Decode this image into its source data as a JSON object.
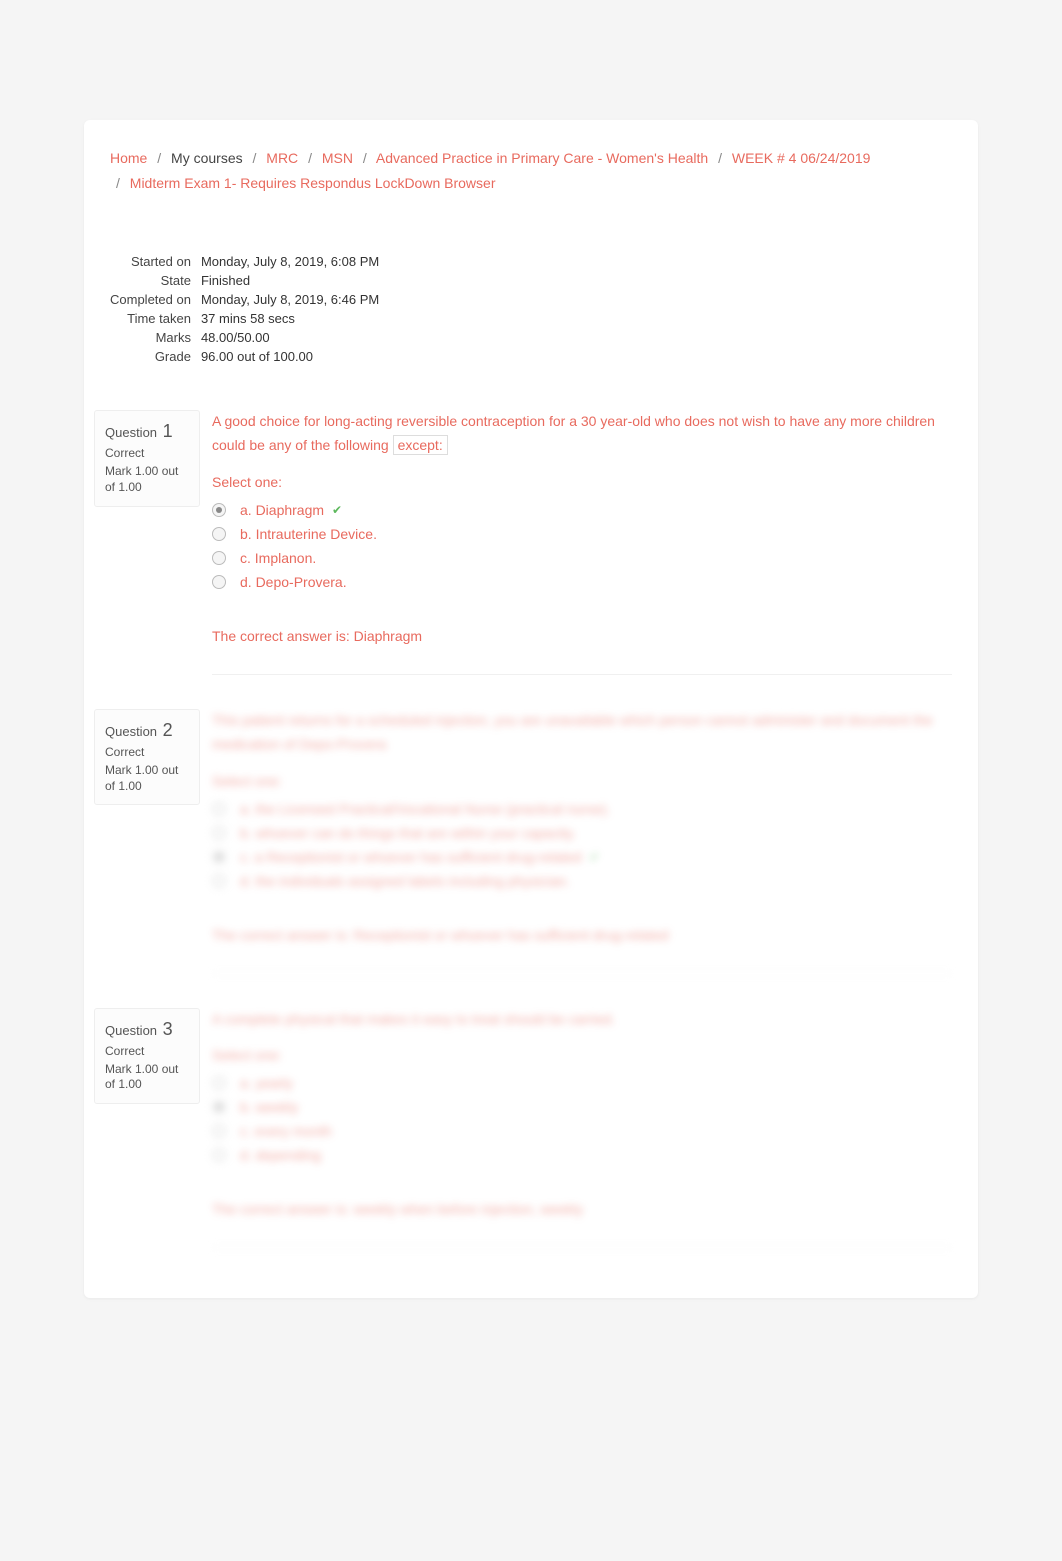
{
  "breadcrumb": {
    "home": "Home",
    "mycourses": "My courses",
    "mrc": "MRC",
    "msn": "MSN",
    "course": "Advanced Practice in Primary Care - Women's Health",
    "week": "WEEK # 4 06/24/2019",
    "exam": "Midterm Exam 1- Requires Respondus LockDown Browser"
  },
  "summary": {
    "started_label": "Started on",
    "started_value": "Monday, July 8, 2019, 6:08 PM",
    "state_label": "State",
    "state_value": "Finished",
    "completed_label": "Completed on",
    "completed_value": "Monday, July 8, 2019, 6:46 PM",
    "time_label": "Time taken",
    "time_value": "37 mins 58 secs",
    "marks_label": "Marks",
    "marks_value": "48.00/50.00",
    "grade_label": "Grade",
    "grade_value": "96.00",
    "grade_suffix": " out of 100.00"
  },
  "questions": [
    {
      "number": "1",
      "label": "Question",
      "state": "Correct",
      "mark": "Mark 1.00 out of 1.00",
      "text_before": "A good choice for long-acting reversible contraception for a 30 year-old who does not wish to have any more children could be any of the following ",
      "text_boxed": "except:",
      "prompt": "Select one:",
      "options": [
        {
          "label": "a. Diaphragm",
          "selected": true,
          "correct_mark": true
        },
        {
          "label": "b. Intrauterine Device.",
          "selected": false,
          "correct_mark": false
        },
        {
          "label": "c. Implanon.",
          "selected": false,
          "correct_mark": false
        },
        {
          "label": "d. Depo-Provera.",
          "selected": false,
          "correct_mark": false
        }
      ],
      "feedback": "The correct answer is: Diaphragm",
      "blurred": false
    },
    {
      "number": "2",
      "label": "Question",
      "state": "Correct",
      "mark": "Mark 1.00 out of 1.00",
      "text_before": "This patient returns for a scheduled injection, you are unavailable which person cannot administer and document the medication of Depo-Provera",
      "text_boxed": "",
      "prompt": "Select one:",
      "options": [
        {
          "label": "a. the Licensed Practical/Vocational Nurse (practical nurse).",
          "selected": false,
          "correct_mark": false
        },
        {
          "label": "b. whoever can do things that are within your capacity.",
          "selected": false,
          "correct_mark": false
        },
        {
          "label": "c. a Receptionist or whoever has sufficient drug-related",
          "selected": true,
          "correct_mark": true
        },
        {
          "label": "d. the individuals assigned labels including physician.",
          "selected": false,
          "correct_mark": false
        }
      ],
      "feedback": "The correct answer is: Receptionist or whoever has sufficient drug-related",
      "blurred": true
    },
    {
      "number": "3",
      "label": "Question",
      "state": "Correct",
      "mark": "Mark 1.00 out of 1.00",
      "text_before": "A complete physical that makes it easy to treat should be carried.",
      "text_boxed": "",
      "prompt": "Select one:",
      "options": [
        {
          "label": "a. yearly",
          "selected": false,
          "correct_mark": false
        },
        {
          "label": "b. weekly",
          "selected": true,
          "correct_mark": true
        },
        {
          "label": "c. every month",
          "selected": false,
          "correct_mark": false
        },
        {
          "label": "d. depending",
          "selected": false,
          "correct_mark": false
        }
      ],
      "feedback": "The correct answer is: weekly when before injection, weekly",
      "blurred": true
    }
  ]
}
